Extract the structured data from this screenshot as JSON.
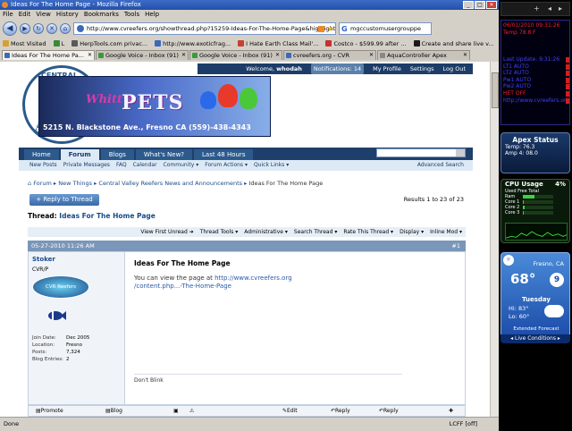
{
  "window": {
    "title": "Ideas For The Home Page - Mozilla Firefox"
  },
  "menu": [
    "File",
    "Edit",
    "View",
    "History",
    "Bookmarks",
    "Tools",
    "Help"
  ],
  "nav": {
    "url": "http://www.cvreefers.org/showthread.php?15259-Ideas-For-The-Home-Page&highlight=",
    "search_value": "mgccustomusergrouppe"
  },
  "bookmarks": [
    {
      "label": "Most Visited",
      "color": "#d8a030"
    },
    {
      "label": "L",
      "color": "#3a8a3a"
    },
    {
      "label": "HerpTools.com privac...",
      "color": "#5a5a5a"
    },
    {
      "label": "http://www.exoticfrag...",
      "color": "#3a6ab8"
    },
    {
      "label": "I Hate Earth Class Mail'...",
      "color": "#c84030"
    },
    {
      "label": "Costco - $599.99 after ...",
      "color": "#c83030"
    },
    {
      "label": "Create and share live v...",
      "color": "#1a1a1a"
    }
  ],
  "tabs": [
    {
      "label": "Ideas For The Home Pa...",
      "color": "#3a6ab8",
      "active": true
    },
    {
      "label": "Google Voice - Inbox (91)",
      "color": "#3a9a3a",
      "active": false
    },
    {
      "label": "Google Voice - Inbox (91)",
      "color": "#3a9a3a",
      "active": false
    },
    {
      "label": "cvreefers.org - CVR",
      "color": "#3a6ab8",
      "active": false
    },
    {
      "label": "AquaController Apex",
      "color": "#888888",
      "active": false
    }
  ],
  "site": {
    "seal_top": "CENTRAL VALLEY",
    "seal_left": "CENTRAL",
    "banner_whit": "Whitt's",
    "banner_pets": "PETS",
    "banner_addr": "5215 N. Blackstone Ave., Fresno CA (559)-438-4343",
    "welcome": "Welcome, ",
    "username": "whodah",
    "notifications": "Notifications: 14",
    "profile": "My Profile",
    "settings": "Settings",
    "logout": "Log Out"
  },
  "navtabs": [
    "Home",
    "Forum",
    "Blogs",
    "What's New?",
    "Last 48 Hours"
  ],
  "subnav": [
    "New Posts",
    "Private Messages",
    "FAQ",
    "Calendar",
    "Community",
    "Forum Actions",
    "Quick Links"
  ],
  "advanced_search": "Advanced Search",
  "breadcrumb": [
    "Forum",
    "New Things",
    "Central Valley Reefers News and Announcements",
    "Ideas For The Home Page"
  ],
  "reply_button": "+ Reply to Thread",
  "results": "Results 1 to 23 of 23",
  "thread": {
    "label": "Thread: ",
    "title": "Ideas For The Home Page"
  },
  "tools": [
    "View First Unread",
    "Thread Tools",
    "Administrative",
    "Search Thread",
    "Rate This Thread",
    "Display",
    "Inline Mod"
  ],
  "post": {
    "date": "05-27-2010 11:26 AM",
    "number": "#1",
    "user": "Stoker",
    "user_title": "CVR/P",
    "avatar_text": "CVR Reefers",
    "join_label": "Join Date:",
    "join": "Dec 2005",
    "loc_label": "Location:",
    "loc": "Fresno",
    "posts_label": "Posts:",
    "posts": "7,324",
    "blog_label": "Blog Entries:",
    "blog": "2",
    "title": "Ideas For The Home Page",
    "text": "You can view the page at ",
    "link1": "http://www.cvreefers.org",
    "link2": "/content.php...-The-Home-Page",
    "signature": "Don't Blink"
  },
  "postfoot": [
    "Promote to Article",
    "Blog this Post",
    "Edit Post",
    "Reply",
    "Reply With Quote"
  ],
  "status": {
    "left": "Done",
    "right": "LCFF [off]"
  },
  "sidebar": {
    "apex_lines": [
      {
        "t": "06/01/2010 09:31:26",
        "c": "red"
      },
      {
        "t": "Temp      78.8 F",
        "c": "red"
      },
      {
        "t": "",
        "c": "red"
      },
      {
        "t": "",
        "c": "red"
      },
      {
        "t": "",
        "c": "red"
      },
      {
        "t": "Last Update: 9:31:26",
        "c": "blue"
      },
      {
        "t": "LT1     AUTO",
        "c": "blue"
      },
      {
        "t": "LT2     AUTO",
        "c": "blue"
      },
      {
        "t": "Pw1     AUTO",
        "c": "blue"
      },
      {
        "t": "Pw2     AUTO",
        "c": "blue"
      },
      {
        "t": "HET     OFF",
        "c": "red"
      },
      {
        "t": "http://www.cvreefers.org",
        "c": "blue"
      }
    ],
    "apex_status_title": "Apex Status",
    "apex_temp": "Temp: 76.3",
    "apex_amp": "Amp 4: 08.0",
    "cpu_title": "CPU Usage",
    "cpu_pct": "4%",
    "cpu_mem": "Used  Free  Total",
    "cpu_rows": [
      {
        "label": "Ram",
        "pct": 38
      },
      {
        "label": "Core 1",
        "pct": 2
      },
      {
        "label": "Core 2",
        "pct": 5
      },
      {
        "label": "Core 3",
        "pct": 3
      }
    ],
    "weather_city": "Fresno, CA",
    "weather_temp": "68°",
    "weather_moon": "9",
    "weather_day": "Tuesday",
    "weather_hi": "Hi: 83°",
    "weather_lo": "Lo: 60°",
    "weather_ext": "Extended Forecast",
    "weather_live": "Live Conditions"
  }
}
